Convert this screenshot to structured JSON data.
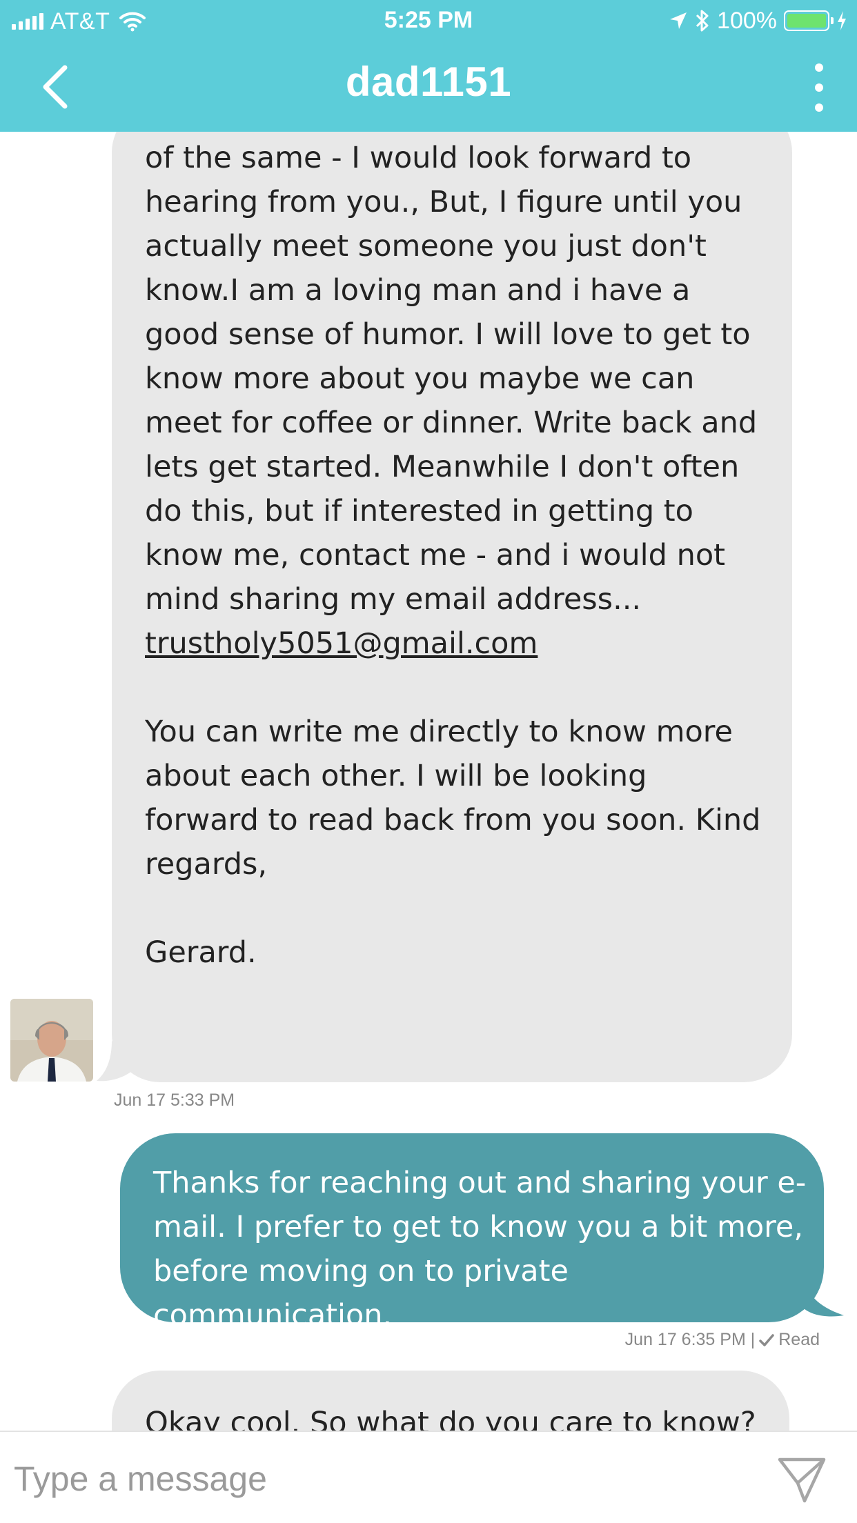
{
  "status_bar": {
    "carrier": "AT&T",
    "time": "5:25 PM",
    "battery": "100%",
    "battery_level": 1.0,
    "icons": [
      "signal-icon",
      "wifi-icon",
      "location-icon",
      "bluetooth-icon",
      "battery-icon",
      "charging-icon"
    ]
  },
  "nav": {
    "title": "dad1151",
    "back_icon": "chevron-left-icon",
    "more_icon": "more-vertical-icon"
  },
  "messages": [
    {
      "direction": "incoming",
      "paragraphs": [
        "of the same - I would look forward to hearing from you., But, I figure until you actually meet someone you just don't know.I am a loving man and i have a good sense of humor. I will love to get to know more about you maybe we can meet for coffee or dinner. Write back and lets get started. Meanwhile I don't often do this, but if interested in getting to know me, contact me - and i would not mind sharing my email address...",
        "You can write me directly to know more about each other. I will be looking forward to read back from you soon. Kind regards,",
        "Gerard."
      ],
      "email": "trustholy5051@gmail.com",
      "timestamp": "Jun 17 5:33 PM"
    },
    {
      "direction": "outgoing",
      "text": "Thanks for reaching out and sharing your e-mail. I prefer to get to know you a bit more, before moving on to private communication.",
      "timestamp": "Jun 17 6:35 PM |",
      "read_label": "Read"
    },
    {
      "direction": "incoming",
      "text": "Okay cool. So what do you care to know? I"
    }
  ],
  "composer": {
    "placeholder": "Type a message",
    "send_icon": "send-icon"
  },
  "colors": {
    "header": "#5ccdd9",
    "incoming_bubble": "#e8e8e8",
    "outgoing_bubble": "#519ea8",
    "battery_fill": "#6ee36e"
  }
}
